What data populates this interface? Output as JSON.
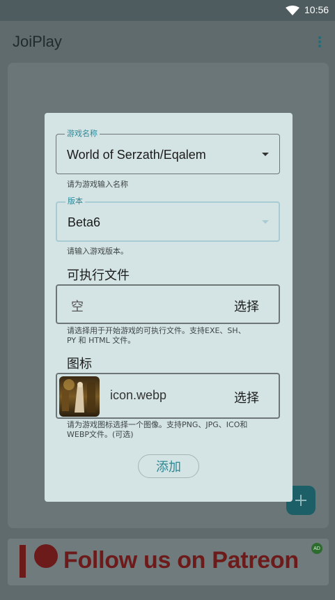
{
  "status_bar": {
    "time": "10:56",
    "wifi_icon": "wifi-icon"
  },
  "app_bar": {
    "title": "JoiPlay",
    "menu_icon": "more-vert-icon"
  },
  "fab": {
    "icon": "plus-icon"
  },
  "banner": {
    "text": "Follow us on Patreon",
    "ad_label": "AD",
    "logo_icon": "patreon-logo-icon"
  },
  "dialog": {
    "name_field": {
      "label": "游戏名称",
      "value": "World of Serzath/Eqalem",
      "helper": "请为游戏输入名称"
    },
    "version_field": {
      "label": "版本",
      "value": "Beta6",
      "helper": "请输入游戏版本。"
    },
    "executable": {
      "title": "可执行文件",
      "value": "空",
      "choose_label": "选择",
      "helper_line1": "请选择用于开始游戏的可执行文件。支持EXE、SH、",
      "helper_line2": "PY 和 HTML 文件。"
    },
    "icon": {
      "title": "图标",
      "filename": "icon.webp",
      "choose_label": "选择",
      "helper_line1": "请为游戏图标选择一个图像。支持PNG、JPG、ICO和",
      "helper_line2": "WEBP文件。(可选)"
    },
    "add_label": "添加"
  },
  "colors": {
    "accent": "#2f8796",
    "patreon": "#6d1a1a",
    "dialog_bg": "#d4e3e3"
  }
}
